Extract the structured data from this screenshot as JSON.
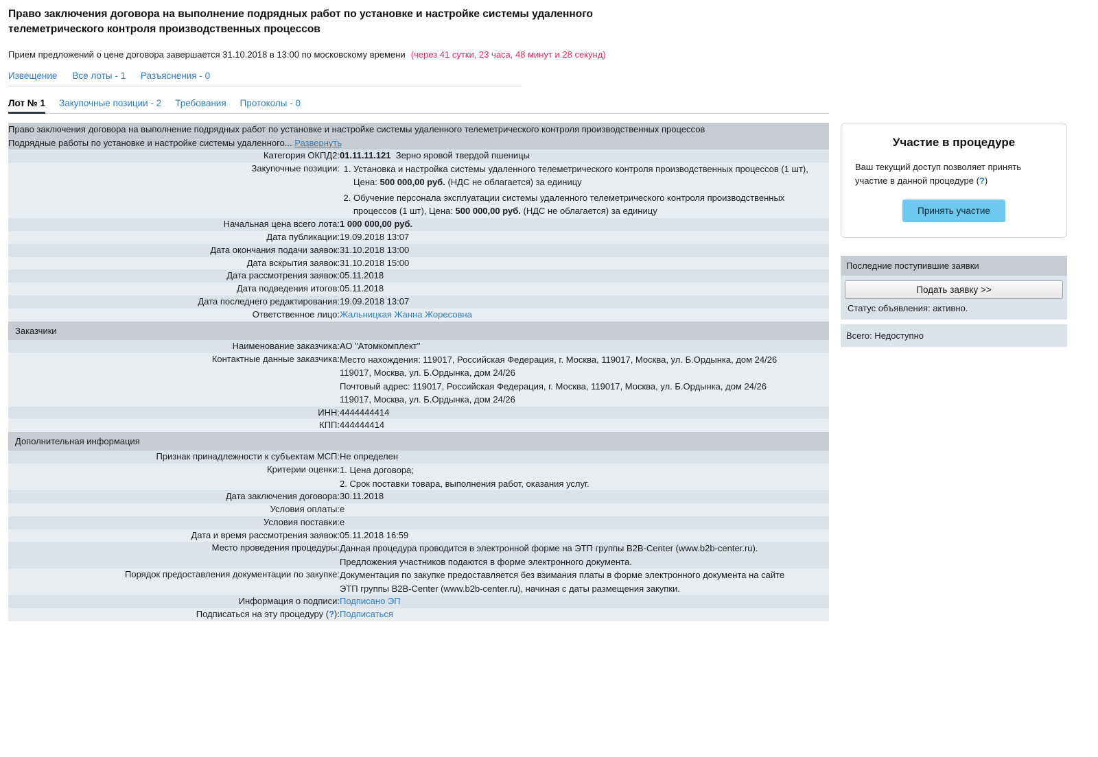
{
  "procedure": {
    "title": "Право заключения договора на выполнение подрядных работ по установке и настройке системы удаленного телеметрического контроля производственных процессов",
    "deadline_text": "Прием предложений о цене договора завершается 31.10.2018 в 13:00 по московскому времени",
    "deadline_counter": "(через 41 сутки, 23 часа, 48 минут и 28 секунд)"
  },
  "nav_top": [
    {
      "label": "Извещение"
    },
    {
      "label": "Все лоты - 1"
    },
    {
      "label": "Разъяснения - 0"
    }
  ],
  "tabs": [
    {
      "label": "Лот № 1",
      "active": true
    },
    {
      "label": "Закупочные позиции - 2",
      "active": false
    },
    {
      "label": "Требования",
      "active": false
    },
    {
      "label": "Протоколы - 0",
      "active": false
    }
  ],
  "lot": {
    "banner_line1": "Право заключения договора на выполнение подрядных работ по установке и настройке системы удаленного телеметрического контроля производственных процессов",
    "banner_line2": "Подрядные работы по установке и настройке системы удаленного...",
    "banner_expand": "Развернуть",
    "okpd2_label": "Категория ОКПД2:",
    "okpd2_code": "01.11.11.121",
    "okpd2_name": "Зерно яровой твердой пшеницы",
    "positions_label": "Закупочные позиции:",
    "positions": [
      {
        "text_before": "Установка и настройка системы удаленного телеметрического контроля производственных процессов (1 шт), Цена:",
        "price": "500 000,00 руб.",
        "text_after": "(НДС не облагается) за единицу"
      },
      {
        "text_before": "Обучение персонала эксплуатации системы удаленного телеметрического контроля производственных процессов (1 шт), Цена:",
        "price": "500 000,00 руб.",
        "text_after": "(НДС не облагается) за единицу"
      }
    ],
    "start_price_label": "Начальная цена всего лота:",
    "start_price_value": "1 000 000,00 руб.",
    "dates": [
      {
        "label": "Дата публикации:",
        "value": "19.09.2018 13:07"
      },
      {
        "label": "Дата окончания подачи заявок:",
        "value": "31.10.2018 13:00"
      },
      {
        "label": "Дата вскрытия заявок:",
        "value": "31.10.2018 15:00"
      },
      {
        "label": "Дата рассмотрения заявок:",
        "value": "05.11.2018"
      },
      {
        "label": "Дата подведения итогов:",
        "value": "05.11.2018"
      },
      {
        "label": "Дата последнего редактирования:",
        "value": "19.09.2018 13:07"
      }
    ],
    "responsible_label": "Ответственное лицо:",
    "responsible_value": "Жальницкая Жанна Жоресовна"
  },
  "customers": {
    "section_title": "Заказчики",
    "name_label": "Наименование заказчика:",
    "name_value": "АО \"Атомкомплект\"",
    "contacts_label": "Контактные данные заказчика:",
    "contacts_lines": [
      "Место нахождения: 119017, Российская Федерация, г. Москва, 119017, Москва, ул. Б.Ордынка, дом 24/26",
      "119017, Москва, ул. Б.Ордынка, дом 24/26",
      "Почтовый адрес: 119017, Российская Федерация, г. Москва, 119017, Москва, ул. Б.Ордынка, дом 24/26",
      "119017, Москва, ул. Б.Ордынка, дом 24/26"
    ],
    "inn_label": "ИНН:",
    "inn_value": "4444444414",
    "kpp_label": "КПП:",
    "kpp_value": "444444414"
  },
  "additional": {
    "section_title": "Дополнительная информация",
    "msp_label": "Признак принадлежности к субъектам МСП:",
    "msp_value": "Не определен",
    "criteria_label": "Критерии оценки:",
    "criteria_lines": [
      "1. Цена договора;",
      "2. Срок поставки товара, выполнения работ, оказания услуг."
    ],
    "contract_date_label": "Дата заключения договора:",
    "contract_date_value": "30.11.2018",
    "payment_label": "Условия оплаты:",
    "payment_value": "е",
    "delivery_label": "Условия поставки:",
    "delivery_value": "е",
    "review_label": "Дата и время рассмотрения заявок:",
    "review_value": "05.11.2018 16:59",
    "place_label": "Место проведения процедуры:",
    "place_lines": [
      "Данная процедура проводится в электронной форме на ЭТП группы B2B-Center (www.b2b-center.ru).",
      "Предложения участников подаются в форме электронного документа."
    ],
    "docs_label": "Порядок предоставления документации по закупке:",
    "docs_lines": [
      "Документация по закупке предоставляется без взимания платы в форме электронного документа на сайте",
      "ЭТП группы B2B-Center (www.b2b-center.ru), начиная с даты размещения закупки."
    ],
    "sign_label": "Информация о подписи:",
    "sign_value": "Подписано ЭП",
    "subscribe_label_before": "Подписаться на эту процедуру (",
    "subscribe_qmark": "?",
    "subscribe_label_after": "):",
    "subscribe_link": "Подписаться"
  },
  "sidebar": {
    "participation": {
      "title": "Участие в процедуре",
      "text_before": "Ваш текущий доступ позволяет принять участие в данной процедуре (",
      "qmark": "?",
      "text_after": ")",
      "button": "Принять участие"
    },
    "bids": {
      "header": "Последние поступившие заявки",
      "submit_button": "Подать заявку >>",
      "status": "Статус объявления: активно.",
      "total": "Всего: Недоступно"
    }
  },
  "colors": {
    "link": "#2d7cc4",
    "counter": "#e8285a",
    "accent_button": "#6ec9f0",
    "row_light": "#e8edf1",
    "row_dark": "#dce2e9",
    "band": "#c6ccd2"
  }
}
